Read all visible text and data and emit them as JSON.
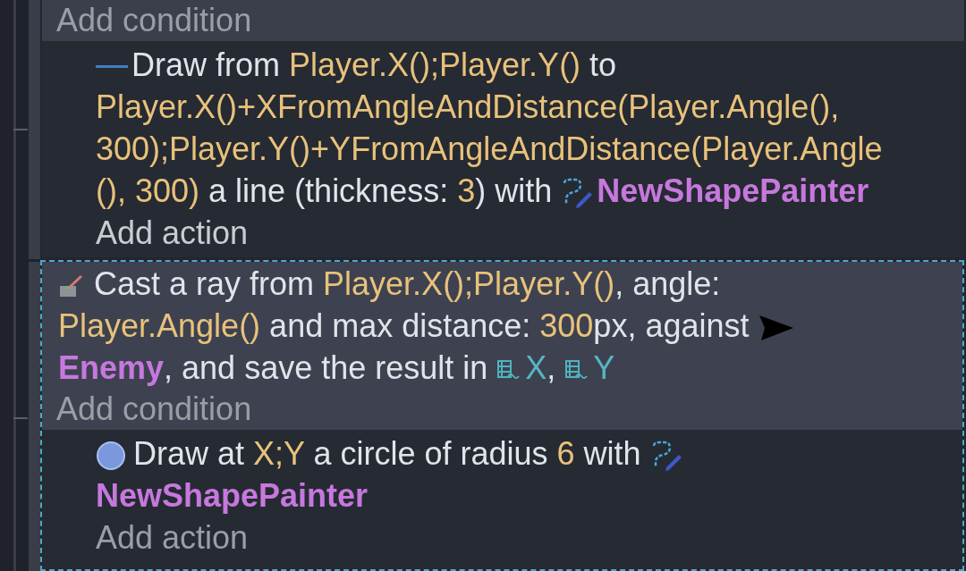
{
  "events": [
    {
      "selected": false,
      "add_condition": "Add condition",
      "add_action": "Add action",
      "actions": [
        {
          "kind": "draw_line",
          "lines": [
            [
              {
                "kind": "text",
                "text": "Draw from "
              },
              {
                "kind": "param",
                "text": "Player.X();Player.Y()"
              },
              {
                "kind": "text",
                "text": " to"
              }
            ],
            [
              {
                "kind": "param",
                "text": "Player.X()+XFromAngleAndDistance(Player.Angle(),"
              }
            ],
            [
              {
                "kind": "param",
                "text": "300);Player.Y()+YFromAngleAndDistance(Player.Angle"
              }
            ],
            [
              {
                "kind": "param",
                "text": "(), 300)"
              },
              {
                "kind": "text",
                "text": " a line (thickness: "
              },
              {
                "kind": "param",
                "text": "3"
              },
              {
                "kind": "text",
                "text": ") with "
              },
              {
                "kind": "painter_icon"
              },
              {
                "kind": "object",
                "text": "NewShapePainter"
              }
            ]
          ]
        }
      ]
    },
    {
      "selected": true,
      "add_condition": "Add condition",
      "conditions": [
        {
          "kind": "raycast",
          "lines": [
            [
              {
                "kind": "text",
                "text": "Cast a ray from "
              },
              {
                "kind": "param",
                "text": "Player.X();Player.Y()"
              },
              {
                "kind": "text",
                "text": ", angle:"
              }
            ],
            [
              {
                "kind": "param",
                "text": "Player.Angle()"
              },
              {
                "kind": "text",
                "text": " and max distance: "
              },
              {
                "kind": "param",
                "text": "300"
              },
              {
                "kind": "text",
                "text": "px, against "
              },
              {
                "kind": "sprite_icon"
              }
            ],
            [
              {
                "kind": "object",
                "text": "Enemy"
              },
              {
                "kind": "text",
                "text": ", and save the result in "
              },
              {
                "kind": "variable_icon"
              },
              {
                "kind": "variable",
                "text": "X"
              },
              {
                "kind": "text",
                "text": ", "
              },
              {
                "kind": "variable_icon"
              },
              {
                "kind": "variable",
                "text": "Y"
              }
            ]
          ]
        }
      ],
      "add_action": "Add action",
      "actions": [
        {
          "kind": "draw_circle",
          "lines": [
            [
              {
                "kind": "text",
                "text": "Draw at "
              },
              {
                "kind": "param",
                "text": "X;Y"
              },
              {
                "kind": "text",
                "text": " a circle of radius "
              },
              {
                "kind": "param",
                "text": "6"
              },
              {
                "kind": "text",
                "text": " with "
              },
              {
                "kind": "painter_icon"
              }
            ],
            [
              {
                "kind": "object",
                "text": "NewShapePainter"
              }
            ]
          ]
        }
      ]
    }
  ]
}
